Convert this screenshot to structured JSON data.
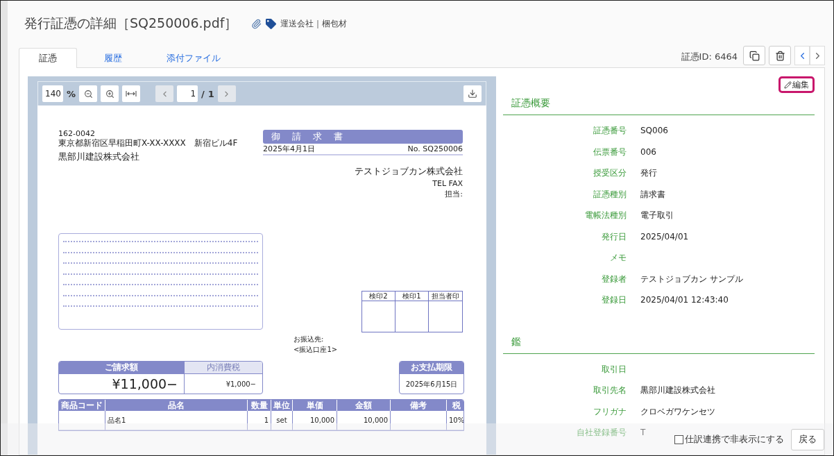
{
  "header": {
    "title": "発行証憑の詳細［SQ250006.pdf］",
    "tags": "運送会社｜梱包材"
  },
  "tabs": [
    {
      "label": "証憑",
      "selected": true
    },
    {
      "label": "履歴",
      "selected": false
    },
    {
      "label": "添付ファイル",
      "selected": false
    }
  ],
  "voucher_id": "証憑ID: 6464",
  "viewer": {
    "zoom": "140",
    "zoom_unit": "%",
    "page": "1",
    "page_separator": "/",
    "page_total": "1"
  },
  "document": {
    "postal_code": "162-0042",
    "address": "東京都新宿区早稲田町X-XX-XXXX　新宿ビル4F",
    "recipient": "黒部川建設株式会社",
    "title": "御　請　求　書",
    "date": "2025年4月1日",
    "number": "No. SQ250006",
    "issuer": "テストジョブカン株式会社",
    "contact": "TEL FAX",
    "person": "担当:",
    "stamps": [
      "検印2",
      "検印1",
      "担当者印"
    ],
    "bank_label": "お振込先:",
    "bank": "<振込口座1>",
    "amount_label": "ご請求額",
    "amount": "¥11,000−",
    "tax_label": "内消費税",
    "tax": "¥1,000−",
    "due_label": "お支払期限",
    "due": "2025年6月15日",
    "columns": [
      "商品コード",
      "品名",
      "数量",
      "単位",
      "単価",
      "金額",
      "備考",
      "税"
    ],
    "rows": [
      {
        "name": "品名1",
        "quantity": "1",
        "unit": "set",
        "unit_price": "10,000",
        "amount": "10,000",
        "tax": "10%"
      }
    ]
  },
  "edit_button": "編集",
  "sections": [
    {
      "title": "証憑概要",
      "fields": [
        {
          "label": "証憑番号",
          "value": "SQ006"
        },
        {
          "label": "伝票番号",
          "value": "006"
        },
        {
          "label": "授受区分",
          "value": "発行"
        },
        {
          "label": "証憑種別",
          "value": "請求書"
        },
        {
          "label": "電帳法種別",
          "value": "電子取引"
        },
        {
          "label": "発行日",
          "value": "2025/04/01"
        },
        {
          "label": "メモ"
        },
        {
          "label": "登録者",
          "value": "テストジョブカン サンプル"
        },
        {
          "label": "登録日",
          "value": "2025/04/01 12:43:40"
        }
      ]
    },
    {
      "title": "鑑",
      "fields": [
        {
          "label": "取引日"
        },
        {
          "label": "取引先名",
          "value": "黒部川建設株式会社"
        },
        {
          "label": "フリガナ",
          "value": "クロベガワケンセツ"
        },
        {
          "label": "自社登録番号",
          "value": "T"
        }
      ]
    }
  ],
  "footer": {
    "hide_checkbox": {
      "label": "仕訳連携で非表示にする",
      "checked": false
    },
    "back_button": "戻る"
  }
}
